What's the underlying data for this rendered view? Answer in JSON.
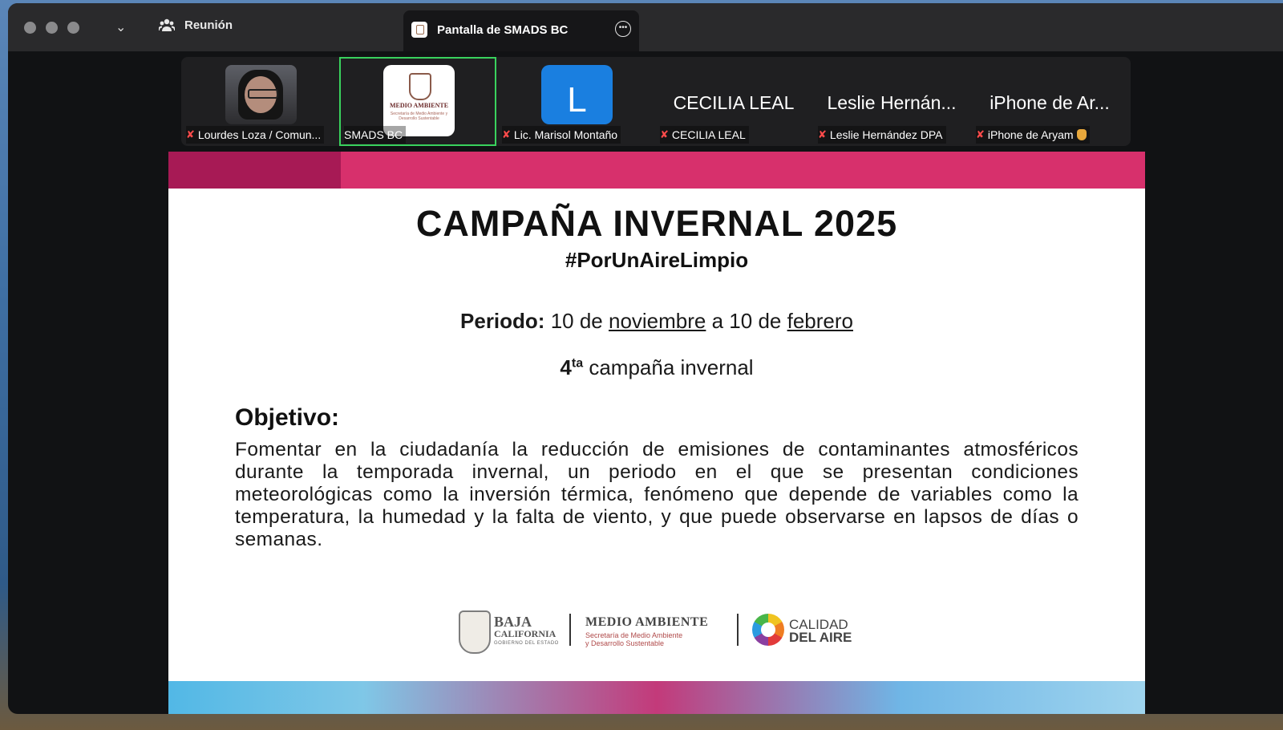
{
  "titlebar": {
    "meeting_label": "Reunión",
    "tab_title": "Pantalla de SMADS BC"
  },
  "participants": [
    {
      "name": "Lourdes Loza / Comun...",
      "muted": true,
      "display": "photo"
    },
    {
      "name": "SMADS BC",
      "muted": false,
      "active": true,
      "display": "logo"
    },
    {
      "name": "Lic. Marisol Montaño",
      "muted": true,
      "display": "avatar",
      "avatar_letter": "L"
    },
    {
      "name": "CECILIA LEAL",
      "muted": true,
      "display": "text",
      "big_label": "CECILIA LEAL"
    },
    {
      "name": "Leslie Hernández DPA",
      "muted": true,
      "display": "text",
      "big_label": "Leslie Hernán..."
    },
    {
      "name": "iPhone de Aryam",
      "muted": true,
      "display": "text",
      "big_label": "iPhone de Ar..."
    }
  ],
  "slide": {
    "title": "CAMPAÑA INVERNAL 2025",
    "hashtag": "#PorUnAireLimpio",
    "periodo_label": "Periodo:",
    "periodo_prefix": " 10 de ",
    "periodo_month1": "noviembre",
    "periodo_mid": " a 10 de ",
    "periodo_month2": "febrero",
    "campana_num": "4",
    "campana_sup": "ta",
    "campana_text": " campaña invernal",
    "objetivo_heading": "Objetivo:",
    "objetivo_text": "Fomentar en la ciudadanía la reducción de emisiones de contaminantes atmosféricos durante la temporada invernal, un periodo en el que se presentan condiciones meteorológicas como la inversión térmica, fenómeno que depende de variables como la temperatura, la humedad y la falta de viento, y que puede observarse en lapsos de días o semanas.",
    "logo_small_title": "MEDIO AMBIENTE",
    "logo_small_sub": "Secretaría de Medio Ambiente y Desarrollo Sustentable",
    "footer": {
      "bc_line1": "BAJA",
      "bc_line2": "CALIFORNIA",
      "bc_line3": "GOBIERNO DEL ESTADO",
      "ma_line1": "MEDIO AMBIENTE",
      "ma_line2": "Secretaría de Medio Ambiente",
      "ma_line3": "y Desarrollo Sustentable",
      "ca_line1": "CALIDAD",
      "ca_line2": "DEL AIRE"
    }
  },
  "colors": {
    "accent_pink": "#d7306c",
    "accent_dark_pink": "#a71a55",
    "active_tile": "#39d25d",
    "avatar_blue": "#1a7fe0"
  },
  "icons": [
    "traffic-light",
    "chevron-down-icon",
    "participants-icon",
    "more-options-icon",
    "mic-muted-icon"
  ]
}
